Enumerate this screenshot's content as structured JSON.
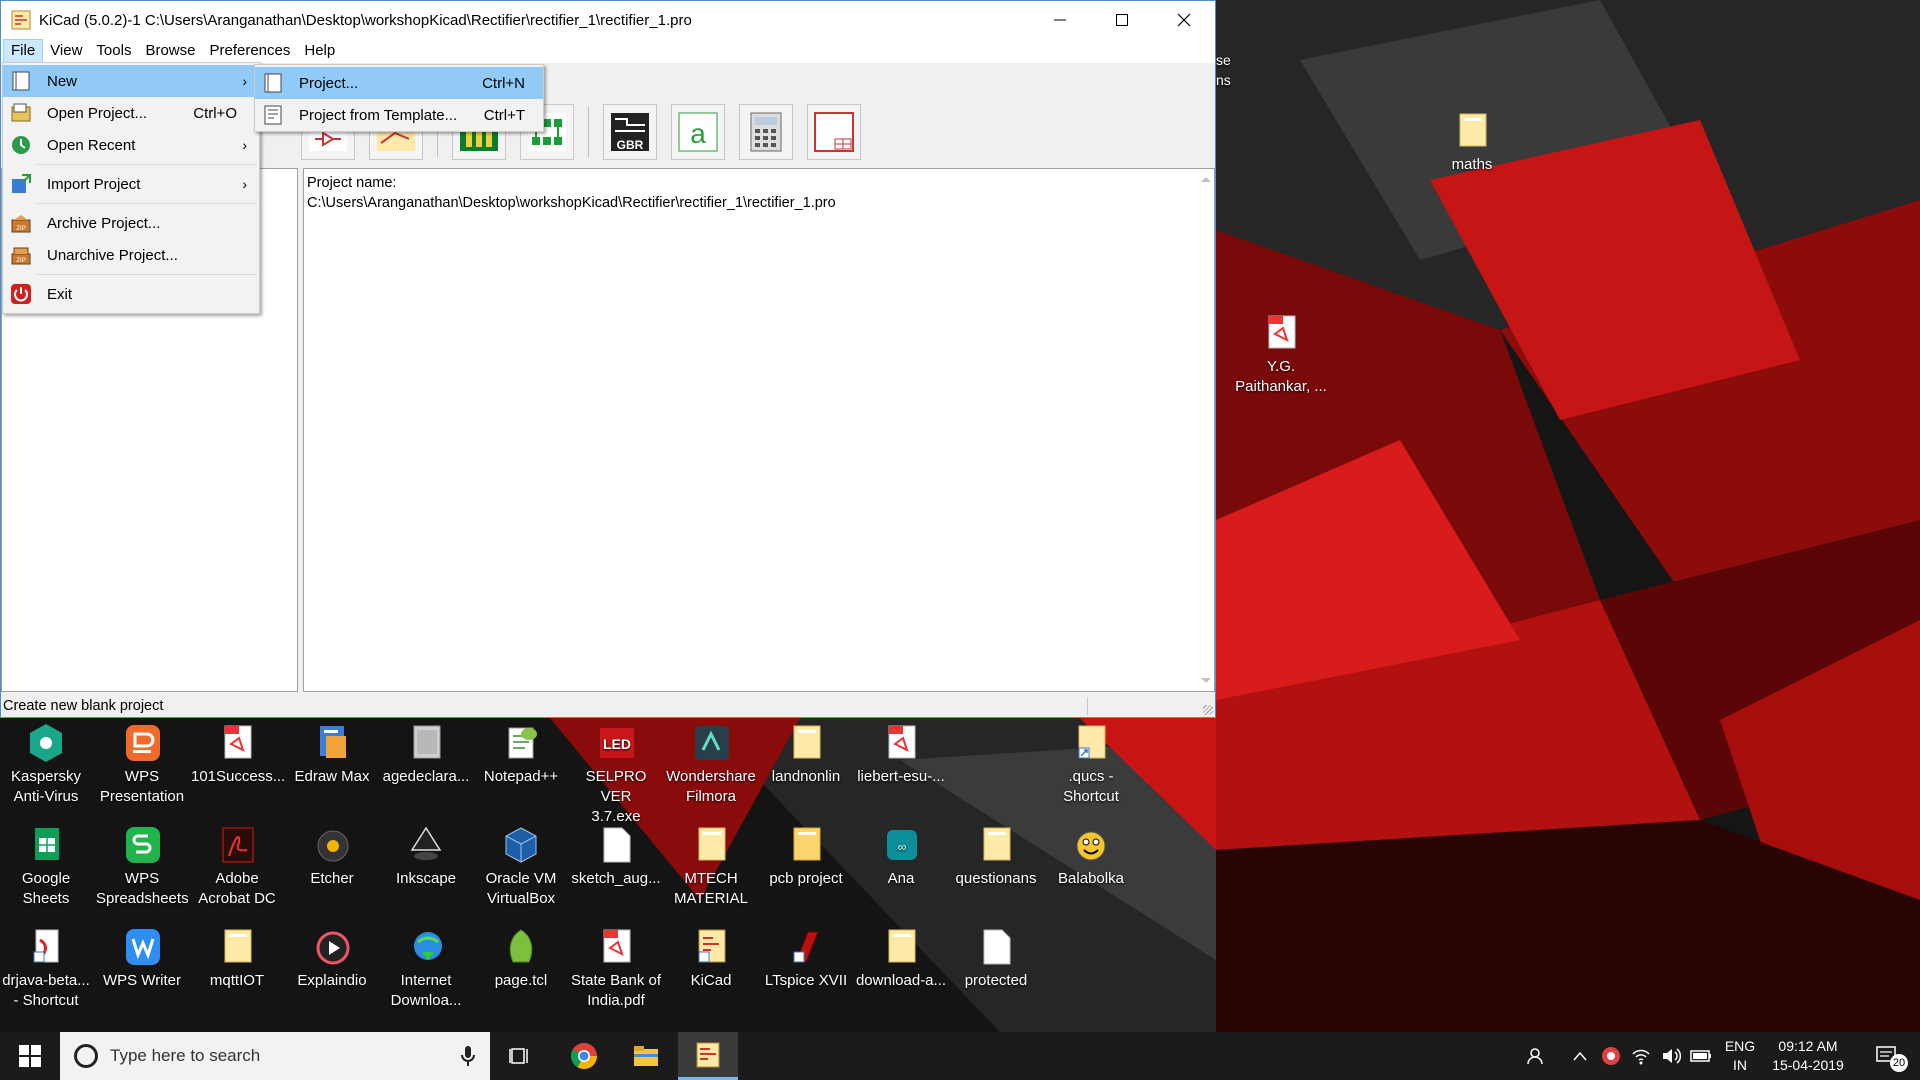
{
  "window": {
    "title": "KiCad (5.0.2)-1 C:\\Users\\Aranganathan\\Desktop\\workshopKicad\\Rectifier\\rectifier_1\\rectifier_1.pro"
  },
  "menubar": {
    "file": "File",
    "view": "View",
    "tools": "Tools",
    "browse": "Browse",
    "preferences": "Preferences",
    "help": "Help"
  },
  "file_menu": {
    "new": "New",
    "open_project": "Open Project...",
    "open_project_shortcut": "Ctrl+O",
    "open_recent": "Open Recent",
    "import_project": "Import Project",
    "archive_project": "Archive Project...",
    "unarchive_project": "Unarchive Project...",
    "exit": "Exit"
  },
  "new_submenu": {
    "project": "Project...",
    "project_shortcut": "Ctrl+N",
    "from_template": "Project from Template...",
    "from_template_shortcut": "Ctrl+T"
  },
  "toolbar": {
    "gerber_label": "GBR"
  },
  "main_panel": {
    "project_label": "Project name:",
    "project_path": "C:\\Users\\Aranganathan\\Desktop\\workshopKicad\\Rectifier\\rectifier_1\\rectifier_1.pro"
  },
  "statusbar": {
    "text": "Create new blank project"
  },
  "desktop_partial": {
    "line1": "se",
    "line2": "ns"
  },
  "desktop_icons": {
    "maths": "maths",
    "paithankar": "Y.G.\nPaithankar, ...",
    "kaspersky": "Kaspersky\nAnti-Virus",
    "wps_presentation": "WPS\nPresentation",
    "success": "101Success...",
    "edraw": "Edraw Max",
    "agedeclara": "agedeclara...",
    "notepadpp": "Notepad++",
    "selpro": "SELPRO VER\n3.7.exe",
    "filmora": "Wondershare\nFilmora",
    "landnonlin": "landnonlin",
    "liebert": "liebert-esu-...",
    "qucs": ".qucs -\nShortcut",
    "google_sheets": "Google\nSheets",
    "wps_spreadsheets": "WPS\nSpreadsheets",
    "acrobat": "Adobe\nAcrobat DC",
    "etcher": "Etcher",
    "inkscape": "Inkscape",
    "virtualbox": "Oracle VM\nVirtualBox",
    "sketch": "sketch_aug...",
    "mtech": "MTECH\nMATERIAL",
    "pcb_project": "pcb project",
    "ana": "Ana",
    "questionans": "questionans",
    "balabolka": "Balabolka",
    "drjava": "drjava-beta...\n- Shortcut",
    "wps_writer": "WPS Writer",
    "mqttiot": "mqttIOT",
    "explaindio": "Explaindio",
    "idm": "Internet\nDownloa...",
    "pagetcl": "page.tcl",
    "sbi": "State Bank of\nIndia.pdf",
    "kicad": "KiCad",
    "ltspice": "LTspice XVII",
    "download": "download-a...",
    "protected": "protected"
  },
  "taskbar": {
    "search_placeholder": "Type here to search",
    "lang": "ENG",
    "region": "IN",
    "time": "09:12 AM",
    "date": "15-04-2019",
    "notification_count": "20"
  }
}
